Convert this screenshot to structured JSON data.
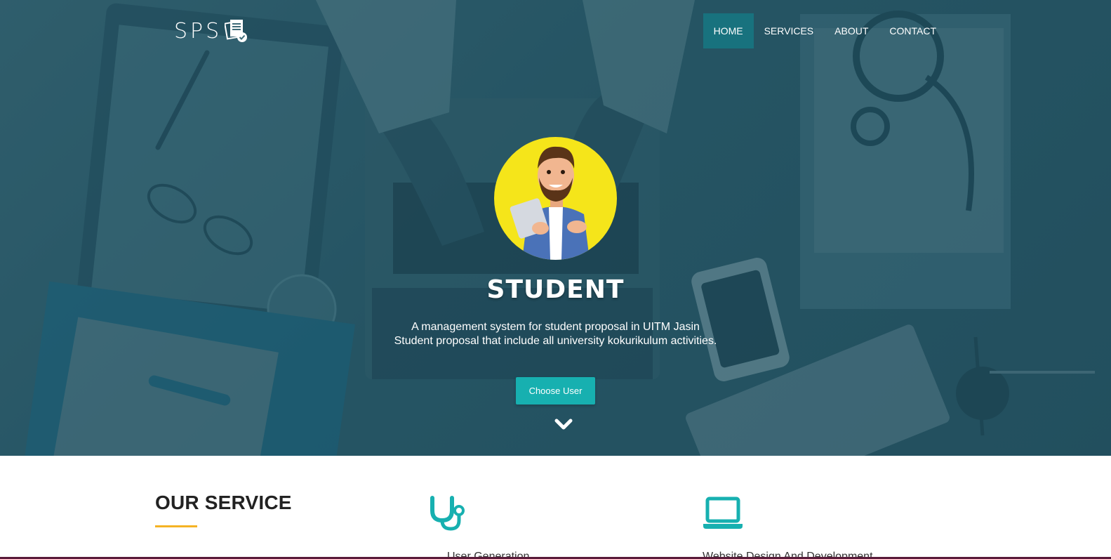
{
  "brand": {
    "logo_text": "SPS"
  },
  "nav": {
    "items": [
      {
        "label": "HOME",
        "active": true
      },
      {
        "label": "SERVICES",
        "active": false
      },
      {
        "label": "ABOUT",
        "active": false
      },
      {
        "label": "CONTACT",
        "active": false
      }
    ]
  },
  "hero": {
    "title": "STUDENT",
    "description_line1": "A management system for student proposal in UITM Jasin",
    "description_line2": "Student proposal that include all university kokurikulum activities.",
    "cta_label": "Choose User",
    "scroll_icon": "chevron-down-icon",
    "avatar_icon": "student-avatar"
  },
  "services": {
    "heading": "OUR SERVICE",
    "items": [
      {
        "icon": "stethoscope-icon",
        "label": "User Generation"
      },
      {
        "icon": "laptop-icon",
        "label": "Website Design And Development"
      }
    ]
  },
  "colors": {
    "accent": "#17b0b0",
    "underline": "#f5b324",
    "hero_tint": "#2f5d6b",
    "avatar_bg": "#f5e51a"
  }
}
